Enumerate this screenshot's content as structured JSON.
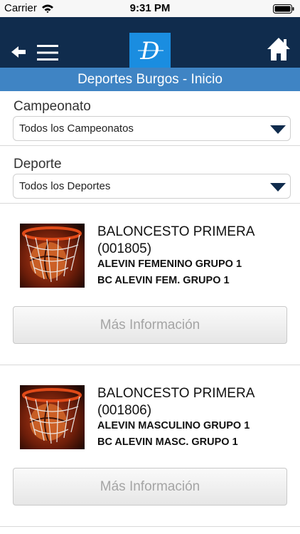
{
  "status_bar": {
    "carrier": "Carrier",
    "time": "9:31 PM"
  },
  "header": {
    "logo_letter": "D",
    "icons": [
      "back-arrow-icon",
      "hamburger-menu-icon",
      "home-icon"
    ],
    "colors": {
      "background": "#102c4d",
      "logo": "#1a8de0"
    }
  },
  "title_bar": {
    "text": "Deportes Burgos - Inicio",
    "color": "#3f84c4"
  },
  "filters": [
    {
      "label": "Campeonato",
      "value": "Todos los Campeonatos"
    },
    {
      "label": "Deporte",
      "value": "Todos los Deportes"
    }
  ],
  "cards": [
    {
      "title_line1": "BALONCESTO PRIMERA",
      "title_line2": "(001805)",
      "category": "ALEVIN FEMENINO GRUPO 1",
      "team": "BC ALEVIN FEM. GRUPO 1",
      "button_label": "Más Información"
    },
    {
      "title_line1": "BALONCESTO PRIMERA",
      "title_line2": "(001806)",
      "category": "ALEVIN MASCULINO GRUPO 1",
      "team": "BC ALEVIN MASC. GRUPO 1",
      "button_label": "Más Información"
    }
  ]
}
